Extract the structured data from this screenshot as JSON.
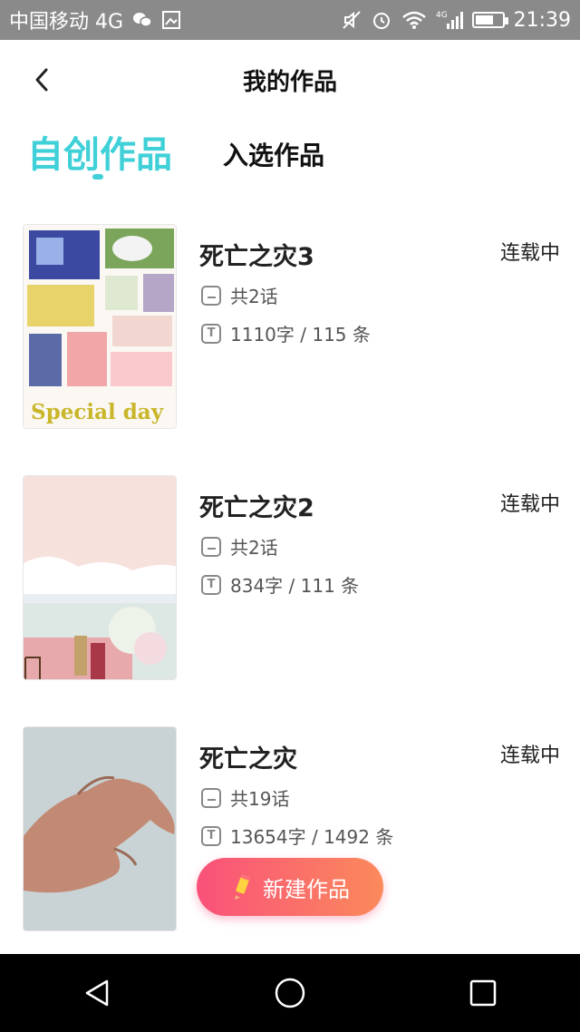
{
  "status_bar": {
    "carrier": "中国移动 4G",
    "time": "21:39",
    "icons": [
      "wechat-icon",
      "image-icon",
      "mute-icon",
      "alarm-icon",
      "wifi-icon",
      "signal-4g-icon",
      "battery-icon"
    ]
  },
  "header": {
    "title": "我的作品",
    "back_icon": "chevron-left-icon"
  },
  "tabs": [
    {
      "label": "自创作品",
      "active": true
    },
    {
      "label": "入选作品",
      "active": false
    }
  ],
  "works": [
    {
      "title": "死亡之灾3",
      "status": "连载中",
      "chapters": "共2话",
      "stats": "1110字 / 115 条",
      "cover_text": "Special day"
    },
    {
      "title": "死亡之灾2",
      "status": "连载中",
      "chapters": "共2话",
      "stats": "834字 / 111 条"
    },
    {
      "title": "死亡之灾",
      "status": "连载中",
      "chapters": "共19话",
      "stats": "13654字 / 1492 条"
    }
  ],
  "new_button": {
    "label": "新建作品",
    "icon": "pencil-icon"
  },
  "nav": {
    "back": "back-triangle-icon",
    "home": "home-circle-icon",
    "recents": "recents-square-icon"
  },
  "colors": {
    "accent": "#3fd0d8",
    "button_start": "#f9517a",
    "button_end": "#fb8a5b"
  }
}
